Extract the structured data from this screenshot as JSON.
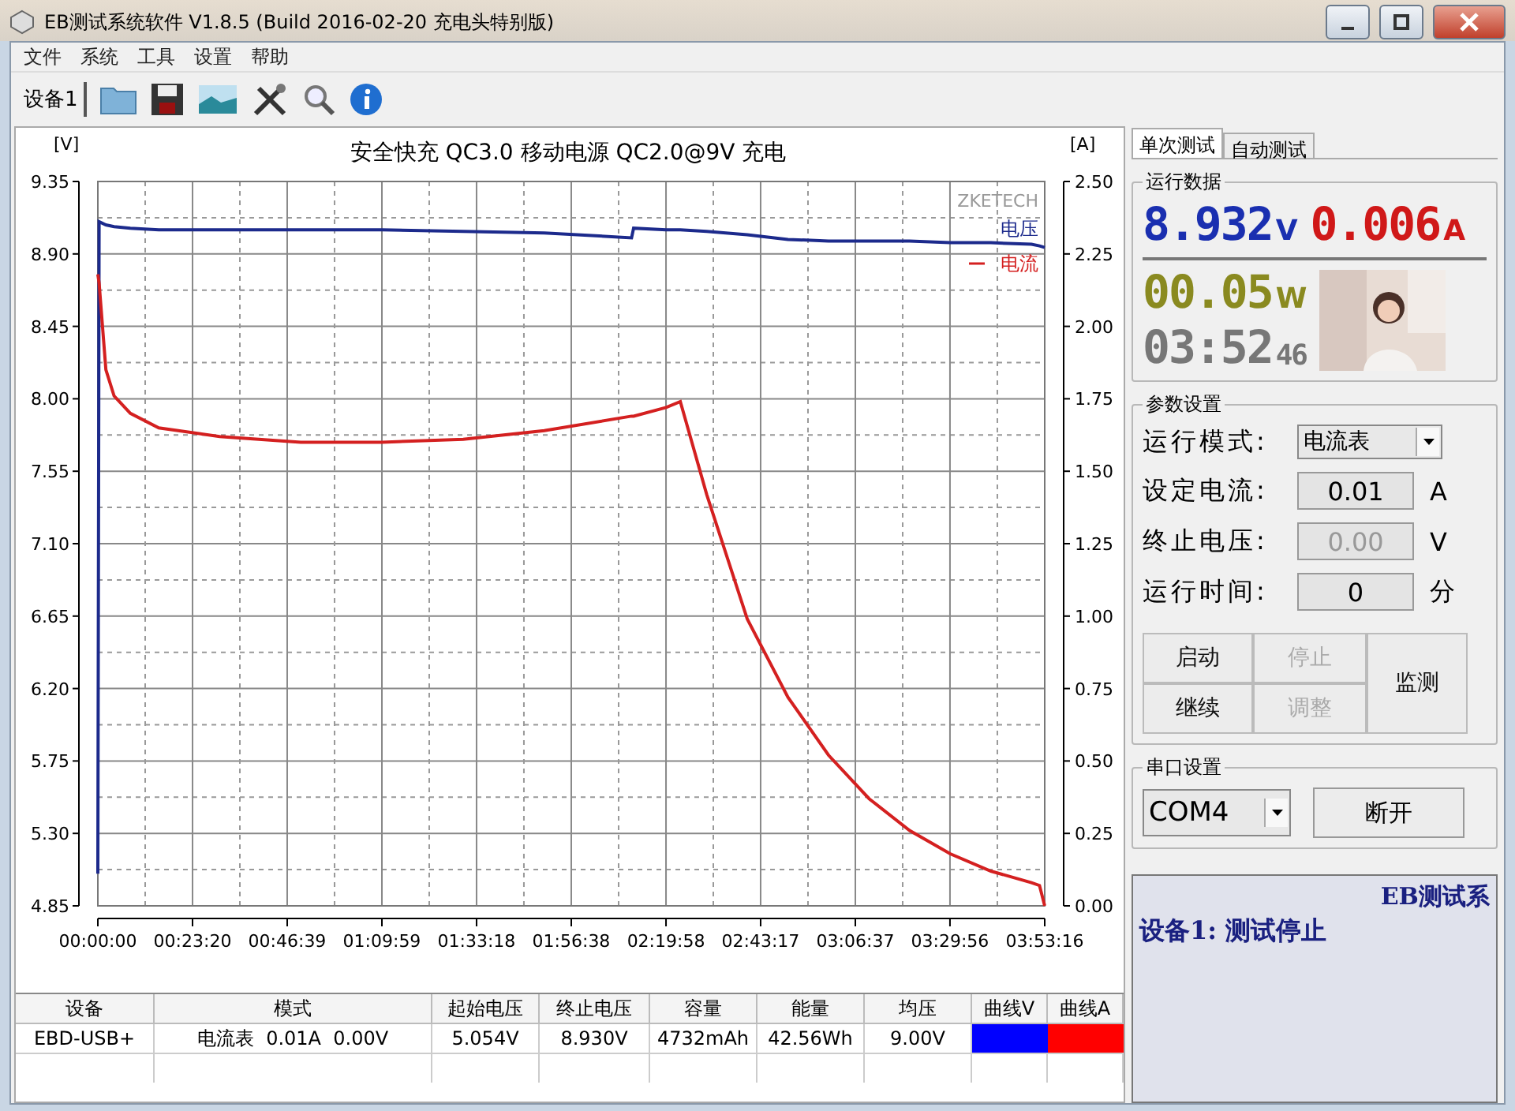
{
  "window": {
    "title": "EB测试系统软件 V1.8.5 (Build 2016-02-20 充电头特别版)"
  },
  "menu": [
    "文件",
    "系统",
    "工具",
    "设置",
    "帮助"
  ],
  "toolbar": {
    "device_tab": "设备1"
  },
  "chart": {
    "chart_data": {
      "type": "line",
      "title": "安全快充 QC3.0 移动电源 QC2.0@9V 充电",
      "ylabel": "[V]",
      "y2label": "[A]",
      "annotations": [
        "ZKETECH"
      ],
      "x": [
        0,
        0.3,
        2,
        4,
        8,
        15,
        30,
        50,
        70,
        90,
        110,
        131.5,
        132,
        140,
        143.5,
        150,
        160,
        170,
        180,
        190,
        200,
        210,
        220,
        230,
        232,
        233.27
      ],
      "series": [
        {
          "name": "电压",
          "color": "#1c2a8c",
          "values": [
            5.05,
            9.1,
            9.08,
            9.07,
            9.06,
            9.05,
            9.05,
            9.05,
            9.05,
            9.04,
            9.03,
            9.0,
            9.06,
            9.05,
            9.05,
            9.04,
            9.02,
            8.99,
            8.98,
            8.98,
            8.98,
            8.97,
            8.97,
            8.96,
            8.95,
            8.94
          ]
        },
        {
          "name": "电流",
          "color": "#d42020",
          "axis": "y2",
          "values": [
            2.18,
            2.15,
            1.85,
            1.76,
            1.7,
            1.65,
            1.62,
            1.6,
            1.6,
            1.61,
            1.64,
            1.69,
            1.69,
            1.72,
            1.74,
            1.42,
            0.99,
            0.72,
            0.52,
            0.37,
            0.26,
            0.18,
            0.12,
            0.08,
            0.07,
            0.0
          ]
        }
      ],
      "grid": true,
      "xlim": [
        0,
        233.27
      ],
      "ylim": [
        4.85,
        9.35
      ],
      "y2lim": [
        0,
        2.5
      ],
      "xticks": [
        {
          "value": 0,
          "label": "00:00:00"
        },
        {
          "value": 23.33,
          "label": "00:23:20"
        },
        {
          "value": 46.65,
          "label": "00:46:39"
        },
        {
          "value": 69.98,
          "label": "01:09:59"
        },
        {
          "value": 93.3,
          "label": "01:33:18"
        },
        {
          "value": 116.63,
          "label": "01:56:38"
        },
        {
          "value": 139.97,
          "label": "02:19:58"
        },
        {
          "value": 163.28,
          "label": "02:43:17"
        },
        {
          "value": 186.62,
          "label": "03:06:37"
        },
        {
          "value": 209.93,
          "label": "03:29:56"
        },
        {
          "value": 233.27,
          "label": "03:53:16"
        }
      ],
      "yticks": [
        {
          "value": 9.35,
          "label": "9.35"
        },
        {
          "value": 8.9,
          "label": "8.90"
        },
        {
          "value": 8.45,
          "label": "8.45"
        },
        {
          "value": 8.0,
          "label": "8.00"
        },
        {
          "value": 7.55,
          "label": "7.55"
        },
        {
          "value": 7.1,
          "label": "7.10"
        },
        {
          "value": 6.65,
          "label": "6.65"
        },
        {
          "value": 6.2,
          "label": "6.20"
        },
        {
          "value": 5.75,
          "label": "5.75"
        },
        {
          "value": 5.3,
          "label": "5.30"
        },
        {
          "value": 4.85,
          "label": "4.85"
        }
      ],
      "y2ticks": [
        {
          "value": 2.5,
          "label": "2.50"
        },
        {
          "value": 2.25,
          "label": "2.25"
        },
        {
          "value": 2.0,
          "label": "2.00"
        },
        {
          "value": 1.75,
          "label": "1.75"
        },
        {
          "value": 1.5,
          "label": "1.50"
        },
        {
          "value": 1.25,
          "label": "1.25"
        },
        {
          "value": 1.0,
          "label": "1.00"
        },
        {
          "value": 0.75,
          "label": "0.75"
        },
        {
          "value": 0.5,
          "label": "0.50"
        },
        {
          "value": 0.25,
          "label": "0.25"
        },
        {
          "value": 0,
          "label": "0.00"
        }
      ]
    }
  },
  "table": {
    "columns": [
      "设备",
      "模式",
      "起始电压",
      "终止电压",
      "容量",
      "能量",
      "均压",
      "曲线V",
      "曲线A"
    ],
    "rows": [
      {
        "cells": [
          "EBD-USB+",
          "电流表  0.01A  0.00V",
          "5.054V",
          "8.930V",
          "4732mAh",
          "42.56Wh",
          "9.00V"
        ],
        "curve_v": {
          "color": "#0000ff"
        },
        "curve_a": {
          "color": "#ff0000"
        }
      }
    ]
  },
  "side_tabs": [
    {
      "label": "单次测试",
      "selected": true
    },
    {
      "label": "自动测试",
      "selected": false
    }
  ],
  "run_data": {
    "title": "运行数据",
    "voltage": "8.932",
    "voltage_unit": "V",
    "current": "0.006",
    "current_unit": "A",
    "power": "00.05",
    "power_unit": "W",
    "time": "03:52",
    "seconds": "46"
  },
  "params": {
    "title": "参数设置",
    "fields": [
      {
        "kind": "select",
        "label": "运行模式:",
        "value": "电流表"
      },
      {
        "kind": "input",
        "label": "设定电流:",
        "value": "0.01",
        "unit": "A",
        "disabled": false
      },
      {
        "kind": "input",
        "label": "终止电压:",
        "value": "0.00",
        "unit": "V",
        "disabled": true
      },
      {
        "kind": "input",
        "label": "运行时间:",
        "value": "0",
        "unit": "分",
        "disabled": false
      }
    ],
    "buttons": [
      {
        "label": "启动",
        "disabled": false
      },
      {
        "label": "停止",
        "disabled": true
      },
      {
        "label": "继续",
        "disabled": false
      },
      {
        "label": "调整",
        "disabled": true
      }
    ],
    "monitor_button": "监测"
  },
  "serial": {
    "title": "串口设置",
    "port": "COM4",
    "button": "断开"
  },
  "status": {
    "marquee": "EB测试系",
    "message": "设备1: 测试停止"
  }
}
